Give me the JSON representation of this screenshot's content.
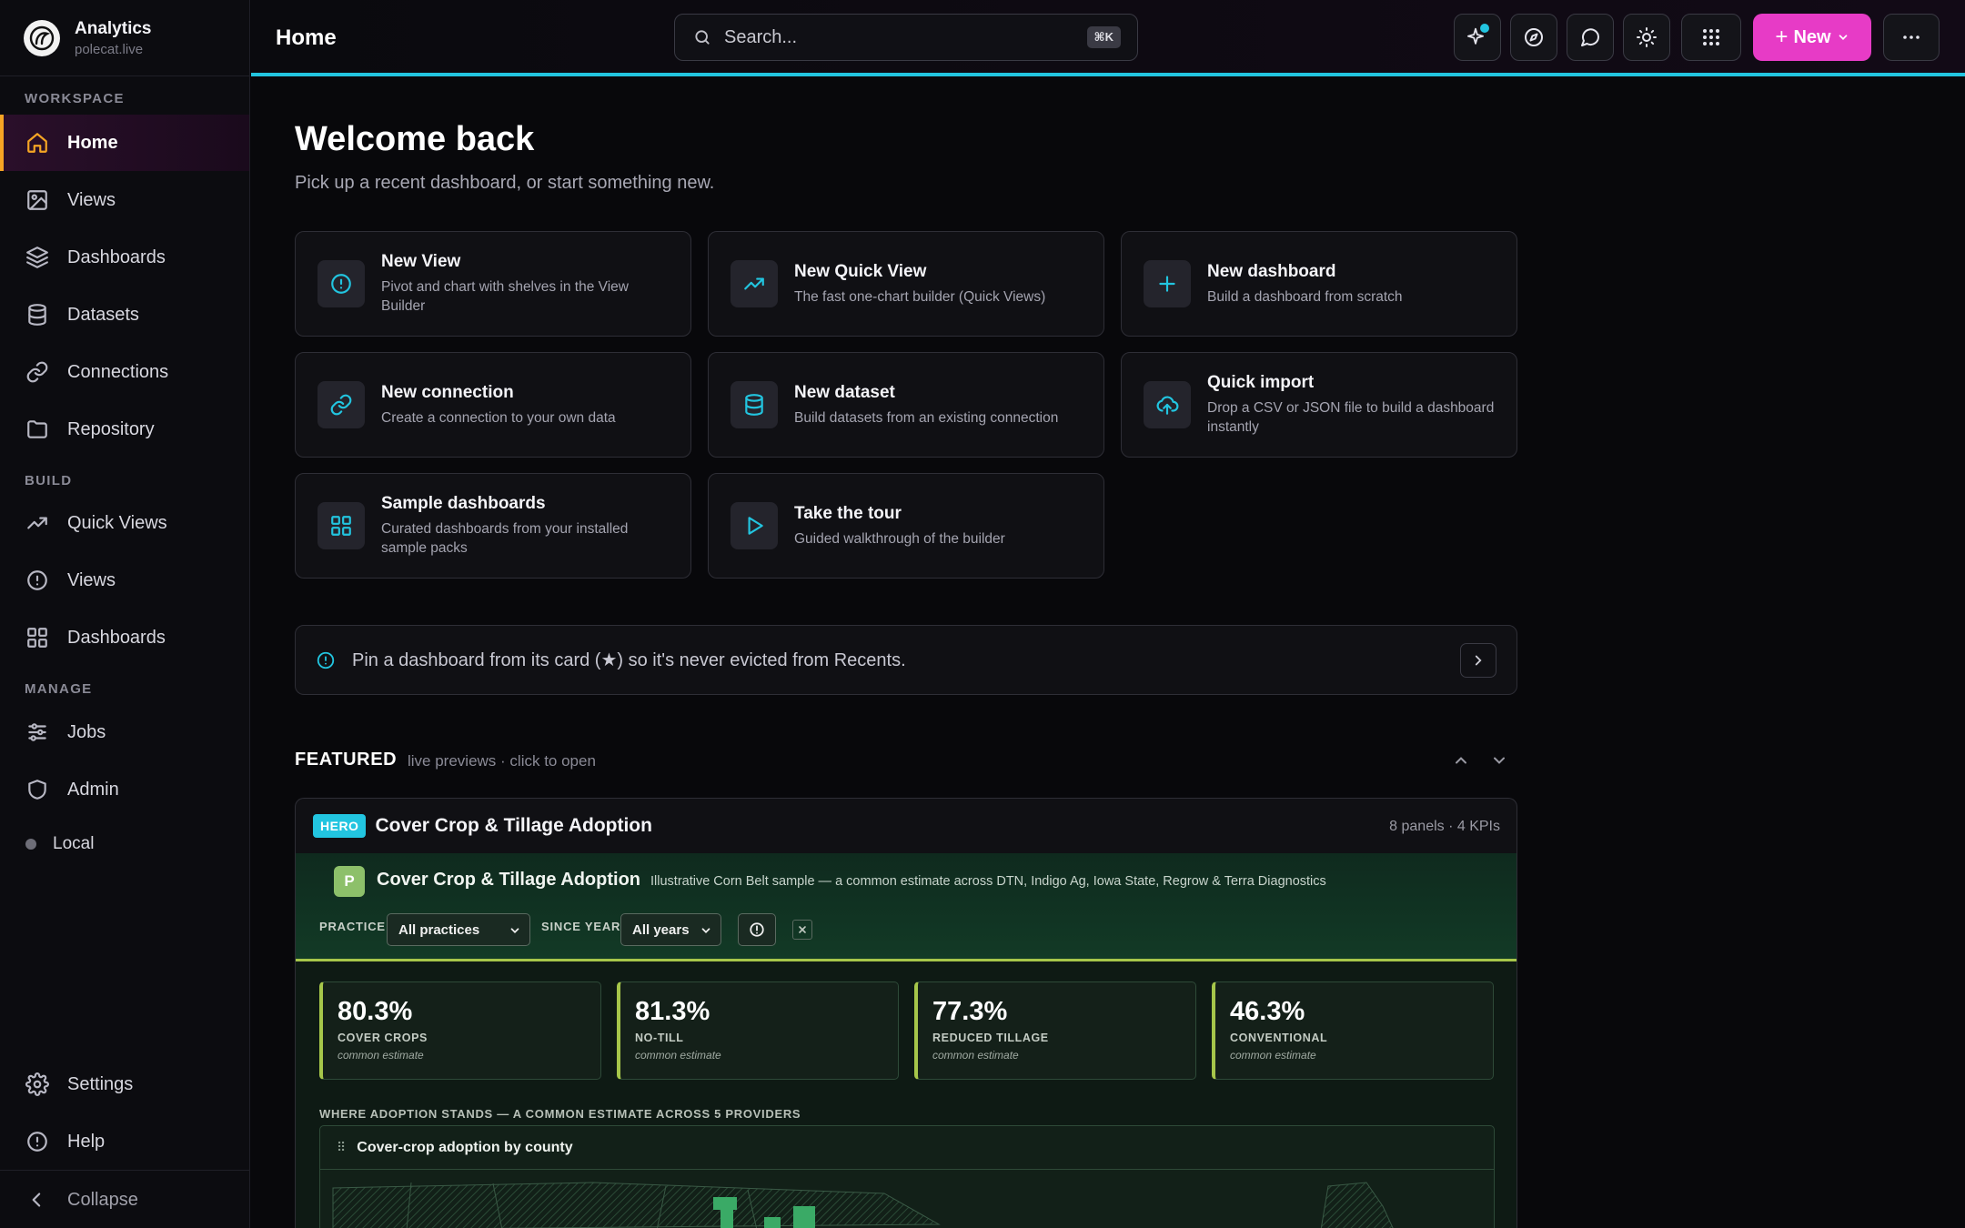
{
  "brand": {
    "name": "Analytics",
    "subtitle": "polecat.live"
  },
  "sidebar": {
    "sections": {
      "workspace": "WORKSPACE",
      "build": "BUILD",
      "manage": "MANAGE"
    },
    "workspace_items": [
      {
        "label": "Home",
        "icon": "home-icon",
        "active": true
      },
      {
        "label": "Views",
        "icon": "image-icon"
      },
      {
        "label": "Dashboards",
        "icon": "layers-icon"
      },
      {
        "label": "Datasets",
        "icon": "database-icon"
      },
      {
        "label": "Connections",
        "icon": "link-icon"
      },
      {
        "label": "Repository",
        "icon": "folder-icon"
      }
    ],
    "build_items": [
      {
        "label": "Quick Views",
        "icon": "trending-up-icon"
      },
      {
        "label": "Views",
        "icon": "info-circle-icon"
      },
      {
        "label": "Dashboards",
        "icon": "grid-icon"
      }
    ],
    "manage_items": [
      {
        "label": "Jobs",
        "icon": "sliders-icon"
      },
      {
        "label": "Admin",
        "icon": "shield-icon"
      },
      {
        "label": "Local",
        "icon": "status-dot"
      }
    ],
    "bottom_items": [
      {
        "label": "Settings",
        "icon": "gear-icon"
      },
      {
        "label": "Help",
        "icon": "info-circle-icon"
      }
    ],
    "collapse_label": "Collapse"
  },
  "topbar": {
    "title": "Home",
    "search_placeholder": "Search...",
    "search_shortcut": "⌘K",
    "new_label": "New",
    "accent": "#22c5e0",
    "new_color": "#e73bc6"
  },
  "main": {
    "welcome": "Welcome back",
    "subtitle": "Pick up a recent dashboard, or start something new.",
    "actions": [
      {
        "title": "New View",
        "desc": "Pivot and chart with shelves in the View Builder",
        "icon": "info-circle-icon"
      },
      {
        "title": "New Quick View",
        "desc": "The fast one-chart builder (Quick Views)",
        "icon": "trending-up-icon"
      },
      {
        "title": "New dashboard",
        "desc": "Build a dashboard from scratch",
        "icon": "plus-icon"
      },
      {
        "title": "New connection",
        "desc": "Create a connection to your own data",
        "icon": "link-icon"
      },
      {
        "title": "New dataset",
        "desc": "Build datasets from an existing connection",
        "icon": "database-icon"
      },
      {
        "title": "Quick import",
        "desc": "Drop a CSV or JSON file to build a dashboard instantly",
        "icon": "upload-cloud-icon"
      },
      {
        "title": "Sample dashboards",
        "desc": "Curated dashboards from your installed sample packs",
        "icon": "grid-icon"
      },
      {
        "title": "Take the tour",
        "desc": "Guided walkthrough of the builder",
        "icon": "play-icon"
      }
    ],
    "tip": "Pin a dashboard from its card (★) so it's never evicted from Recents.",
    "featured": {
      "title": "FEATURED",
      "subtitle": "live previews · click to open"
    },
    "hero": {
      "badge": "HERO",
      "title": "Cover Crop & Tillage Adoption",
      "meta": "8 panels · 4 KPIs",
      "preview": {
        "logo_letter": "P",
        "title": "Cover Crop & Tillage Adoption",
        "description": "Illustrative Corn Belt sample — a common estimate across DTN, Indigo Ag, Iowa State, Regrow & Terra Diagnostics",
        "filters": {
          "practice_label": "PRACTICE",
          "practice_value": "All practices",
          "year_label": "SINCE YEAR",
          "year_value": "All years"
        },
        "kpis": [
          {
            "value": "80.3%",
            "label": "COVER CROPS",
            "note": "common estimate"
          },
          {
            "value": "81.3%",
            "label": "NO-TILL",
            "note": "common estimate"
          },
          {
            "value": "77.3%",
            "label": "REDUCED TILLAGE",
            "note": "common estimate"
          },
          {
            "value": "46.3%",
            "label": "CONVENTIONAL",
            "note": "common estimate"
          }
        ],
        "section_title": "WHERE ADOPTION STANDS — A COMMON ESTIMATE ACROSS 5 PROVIDERS",
        "panel_title": "Cover-crop adoption by county"
      }
    }
  }
}
